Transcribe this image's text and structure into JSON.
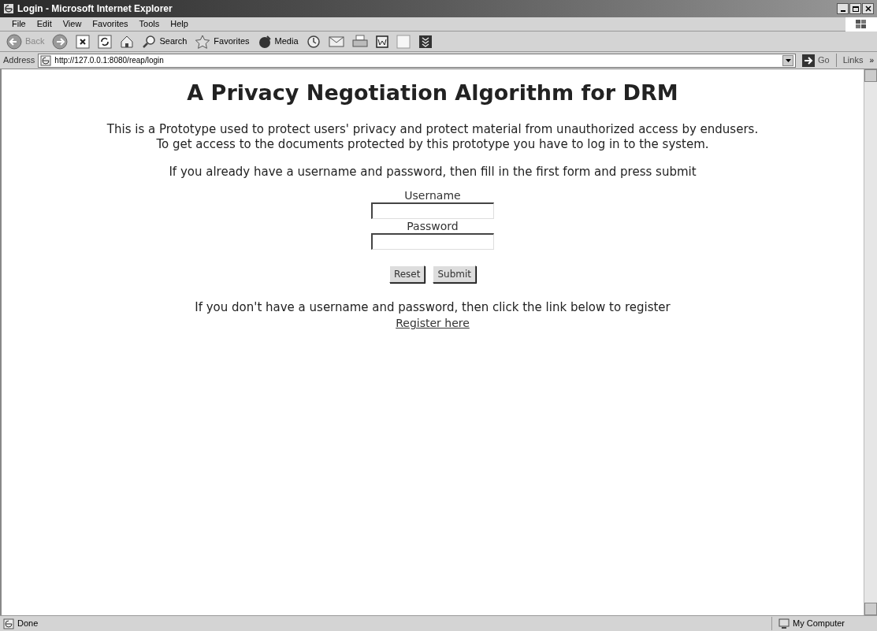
{
  "window": {
    "title": "Login - Microsoft Internet Explorer"
  },
  "menu": [
    "File",
    "Edit",
    "View",
    "Favorites",
    "Tools",
    "Help"
  ],
  "toolbar": [
    {
      "kind": "back",
      "label": "Back"
    },
    {
      "kind": "forward"
    },
    {
      "kind": "stop"
    },
    {
      "kind": "refresh"
    },
    {
      "kind": "home"
    },
    {
      "kind": "search",
      "label": "Search"
    },
    {
      "kind": "favorites",
      "label": "Favorites"
    },
    {
      "kind": "media",
      "label": "Media"
    },
    {
      "kind": "history"
    },
    {
      "kind": "mail"
    },
    {
      "kind": "print"
    },
    {
      "kind": "word"
    },
    {
      "kind": "blank"
    },
    {
      "kind": "chevrons"
    }
  ],
  "address": {
    "label": "Address",
    "value": "http://127.0.0.1:8080/reap/login",
    "go": "Go",
    "links": "Links",
    "more": "»"
  },
  "page": {
    "heading": "A Privacy Negotiation Algorithm for DRM",
    "intro": [
      "This is a Prototype used to protect users' privacy and protect material from unauthorized access by endusers.",
      "To get access to the documents protected by this prototype you have to log in to the system."
    ],
    "login_prompt": "If you already have a username and password, then fill in the first form and press submit",
    "fields": [
      {
        "label": "Username"
      },
      {
        "label": "Password"
      }
    ],
    "buttons": [
      "Reset",
      "Submit"
    ],
    "register_prompt": "If you don't have a username and password, then click the link below to register",
    "register_link": "Register here"
  },
  "status_bar": {
    "text": "Done",
    "zone": "My Computer"
  }
}
